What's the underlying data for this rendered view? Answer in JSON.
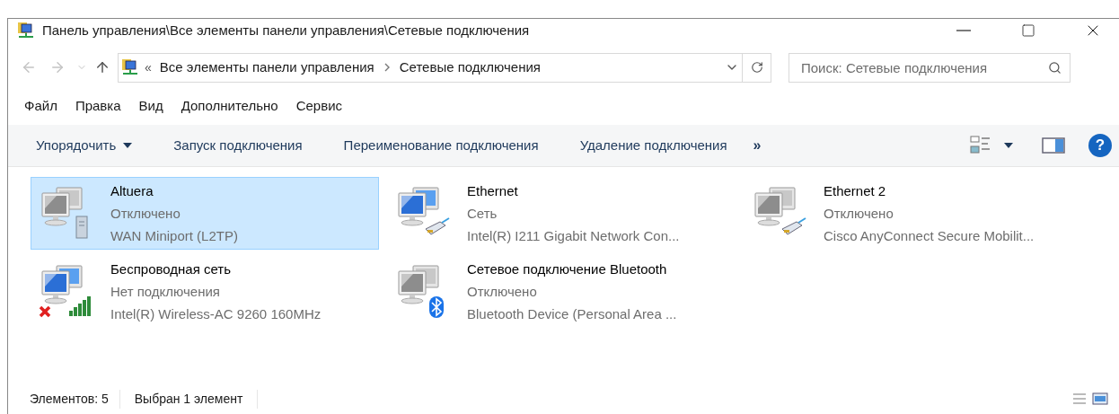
{
  "window": {
    "title": "Панель управления\\Все элементы панели управления\\Сетевые подключения"
  },
  "address_bar": {
    "prefix": "«",
    "path": [
      {
        "label": "Все элементы панели управления"
      },
      {
        "label": "Сетевые подключения"
      }
    ]
  },
  "search": {
    "placeholder": "Поиск: Сетевые подключения"
  },
  "menu": [
    {
      "label": "Файл"
    },
    {
      "label": "Правка"
    },
    {
      "label": "Вид"
    },
    {
      "label": "Дополнительно"
    },
    {
      "label": "Сервис"
    }
  ],
  "commands": [
    {
      "label": "Упорядочить",
      "dropdown": true
    },
    {
      "label": "Запуск подключения",
      "dropdown": false
    },
    {
      "label": "Переименование подключения",
      "dropdown": false
    },
    {
      "label": "Удаление подключения",
      "dropdown": false
    }
  ],
  "more": "»",
  "help": "?",
  "connections": [
    {
      "name": "Altuera",
      "status": "Отключено",
      "device": "WAN Miniport (L2TP)",
      "kind": "vpn",
      "enabled": false,
      "error": false,
      "selected": true
    },
    {
      "name": "Ethernet",
      "status": "Сеть",
      "device": "Intel(R) I211 Gigabit Network Con...",
      "kind": "ethernet",
      "enabled": true,
      "error": false,
      "selected": false
    },
    {
      "name": "Ethernet 2",
      "status": "Отключено",
      "device": "Cisco AnyConnect Secure Mobilit...",
      "kind": "ethernet",
      "enabled": false,
      "error": false,
      "selected": false
    },
    {
      "name": "Беспроводная сеть",
      "status": "Нет подключения",
      "device": "Intel(R) Wireless-AC 9260 160MHz",
      "kind": "wifi",
      "enabled": true,
      "error": true,
      "selected": false
    },
    {
      "name": "Сетевое подключение Bluetooth",
      "status": "Отключено",
      "device": "Bluetooth Device (Personal Area ...",
      "kind": "bluetooth",
      "enabled": false,
      "error": false,
      "selected": false
    }
  ],
  "status_bar": {
    "count": "Элементов: 5",
    "selection": "Выбран 1 элемент"
  }
}
